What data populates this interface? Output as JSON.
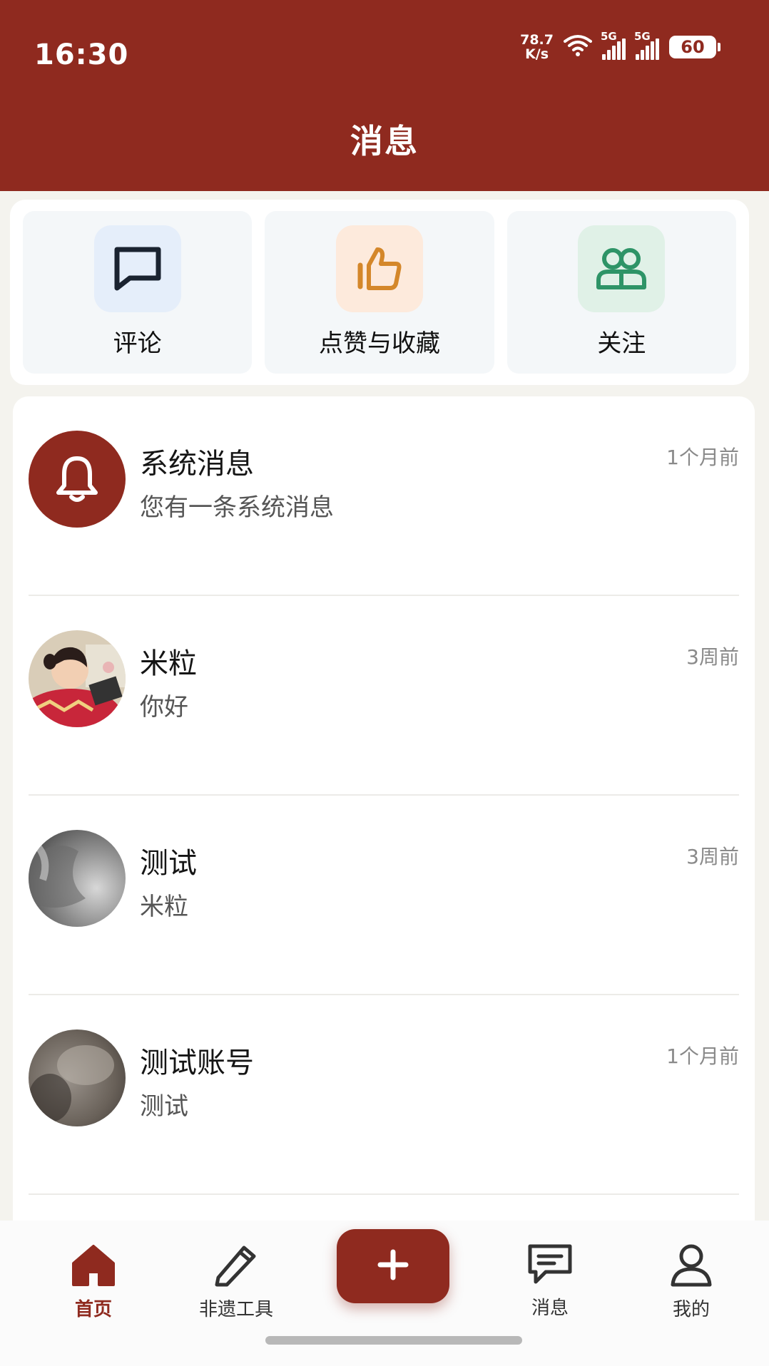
{
  "status_bar": {
    "time": "16:30",
    "net_speed_value": "78.7",
    "net_speed_unit": "K/s",
    "signal_1_tag": "5G",
    "signal_2_tag": "5G",
    "battery": "60"
  },
  "header": {
    "title": "消息"
  },
  "quick_actions": [
    {
      "label": "评论",
      "icon": "comment-icon",
      "bg": "#e5eefa",
      "color": "#1a2330"
    },
    {
      "label": "点赞与收藏",
      "icon": "thumbs-up-icon",
      "bg": "#fdeadc",
      "color": "#d4872a"
    },
    {
      "label": "关注",
      "icon": "users-icon",
      "bg": "#e0f1e7",
      "color": "#2e9467"
    }
  ],
  "messages": [
    {
      "name": "系统消息",
      "preview": "您有一条系统消息",
      "time": "1个月前",
      "avatar": "bell-icon"
    },
    {
      "name": "米粒",
      "preview": "你好",
      "time": "3周前",
      "avatar": "photo"
    },
    {
      "name": "测试",
      "preview": "米粒",
      "time": "3周前",
      "avatar": "photo"
    },
    {
      "name": "测试账号",
      "preview": "测试",
      "time": "1个月前",
      "avatar": "photo"
    }
  ],
  "bottom_nav": {
    "home": "首页",
    "tools": "非遗工具",
    "messages": "消息",
    "profile": "我的"
  },
  "colors": {
    "brand": "#8f2a1f",
    "background": "#f4f3ee"
  }
}
